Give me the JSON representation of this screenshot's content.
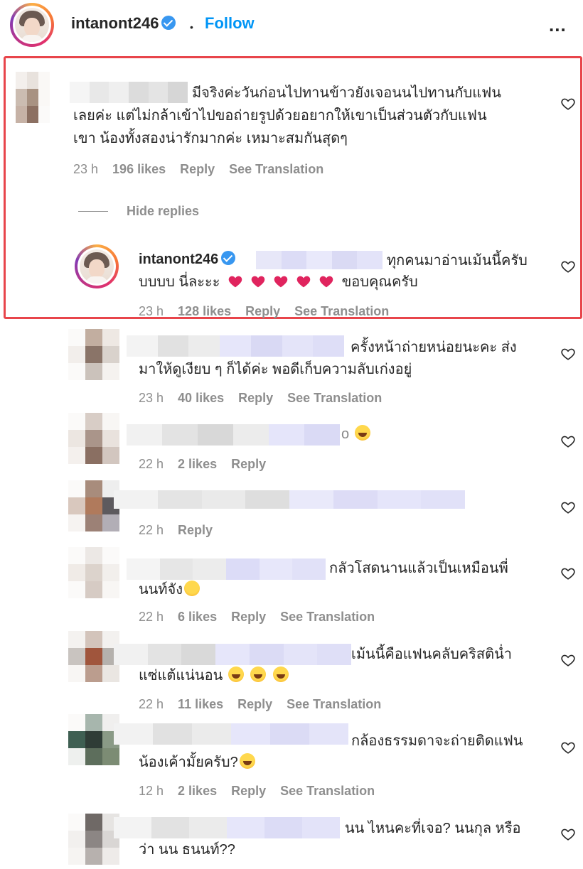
{
  "header": {
    "username": "intanont246",
    "separator": "•",
    "follow_label": "Follow",
    "more_label": "..."
  },
  "comments": [
    {
      "text_line1": "มีจริงค่ะวันก่อนไปทานข้าวยังเจอนนไปทานกับแฟน",
      "text_line2": "เลยค่ะ แต่ไม่กล้าเข้าไปขอถ่ายรูปด้วยอยากให้เขาเป็นส่วนตัวกับแฟน",
      "text_line3": "เขา น้องทั้งสองน่ารักมากค่ะ เหมาะสมกันสุดๆ",
      "time": "23 h",
      "likes": "196 likes",
      "reply": "Reply",
      "translation": "See Translation"
    },
    {
      "hide_replies": "Hide replies",
      "username": "intanont246",
      "text_line1": "ทุกคนมาอ่านเม้นนี้ครับ",
      "text_line2_pre": "บบบบ นี่ละะะ",
      "text_line2_post": "ขอบคุณครับ",
      "time": "23 h",
      "likes": "128 likes",
      "reply": "Reply",
      "translation": "See Translation"
    },
    {
      "text_line1": "ครั้งหน้าถ่ายหน่อยนะคะ ส่ง",
      "text_line2": "มาให้ดูเงียบ ๆ ก็ได้ค่ะ พอดีเก็บความลับเก่งอยู่",
      "time": "23 h",
      "likes": "40 likes",
      "reply": "Reply",
      "translation": "See Translation"
    },
    {
      "text_line1": "o",
      "time": "22 h",
      "likes": "2 likes",
      "reply": "Reply"
    },
    {
      "time": "22 h",
      "reply": "Reply"
    },
    {
      "text_line1": "กลัวโสดนานแล้วเป็นเหมือนพี่",
      "text_line2": "นนท์จัง",
      "time": "22 h",
      "likes": "6 likes",
      "reply": "Reply",
      "translation": "See Translation"
    },
    {
      "text_line1": "เม้นนี้คือแฟนคลับคริสตินํ่า",
      "text_line2": "แซ่แต้แน่นอน",
      "time": "22 h",
      "likes": "11 likes",
      "reply": "Reply",
      "translation": "See Translation"
    },
    {
      "text_line1": "กล้องธรรมดาจะถ่ายติดแฟน",
      "text_line2": "น้องเค้ามั้ยครับ?",
      "time": "12 h",
      "likes": "2 likes",
      "reply": "Reply",
      "translation": "See Translation"
    },
    {
      "text_line1": "นน ไหนคะที่เจอ? นนกุล หรือ",
      "text_line2": "ว่า นน ธนนท์??"
    }
  ]
}
